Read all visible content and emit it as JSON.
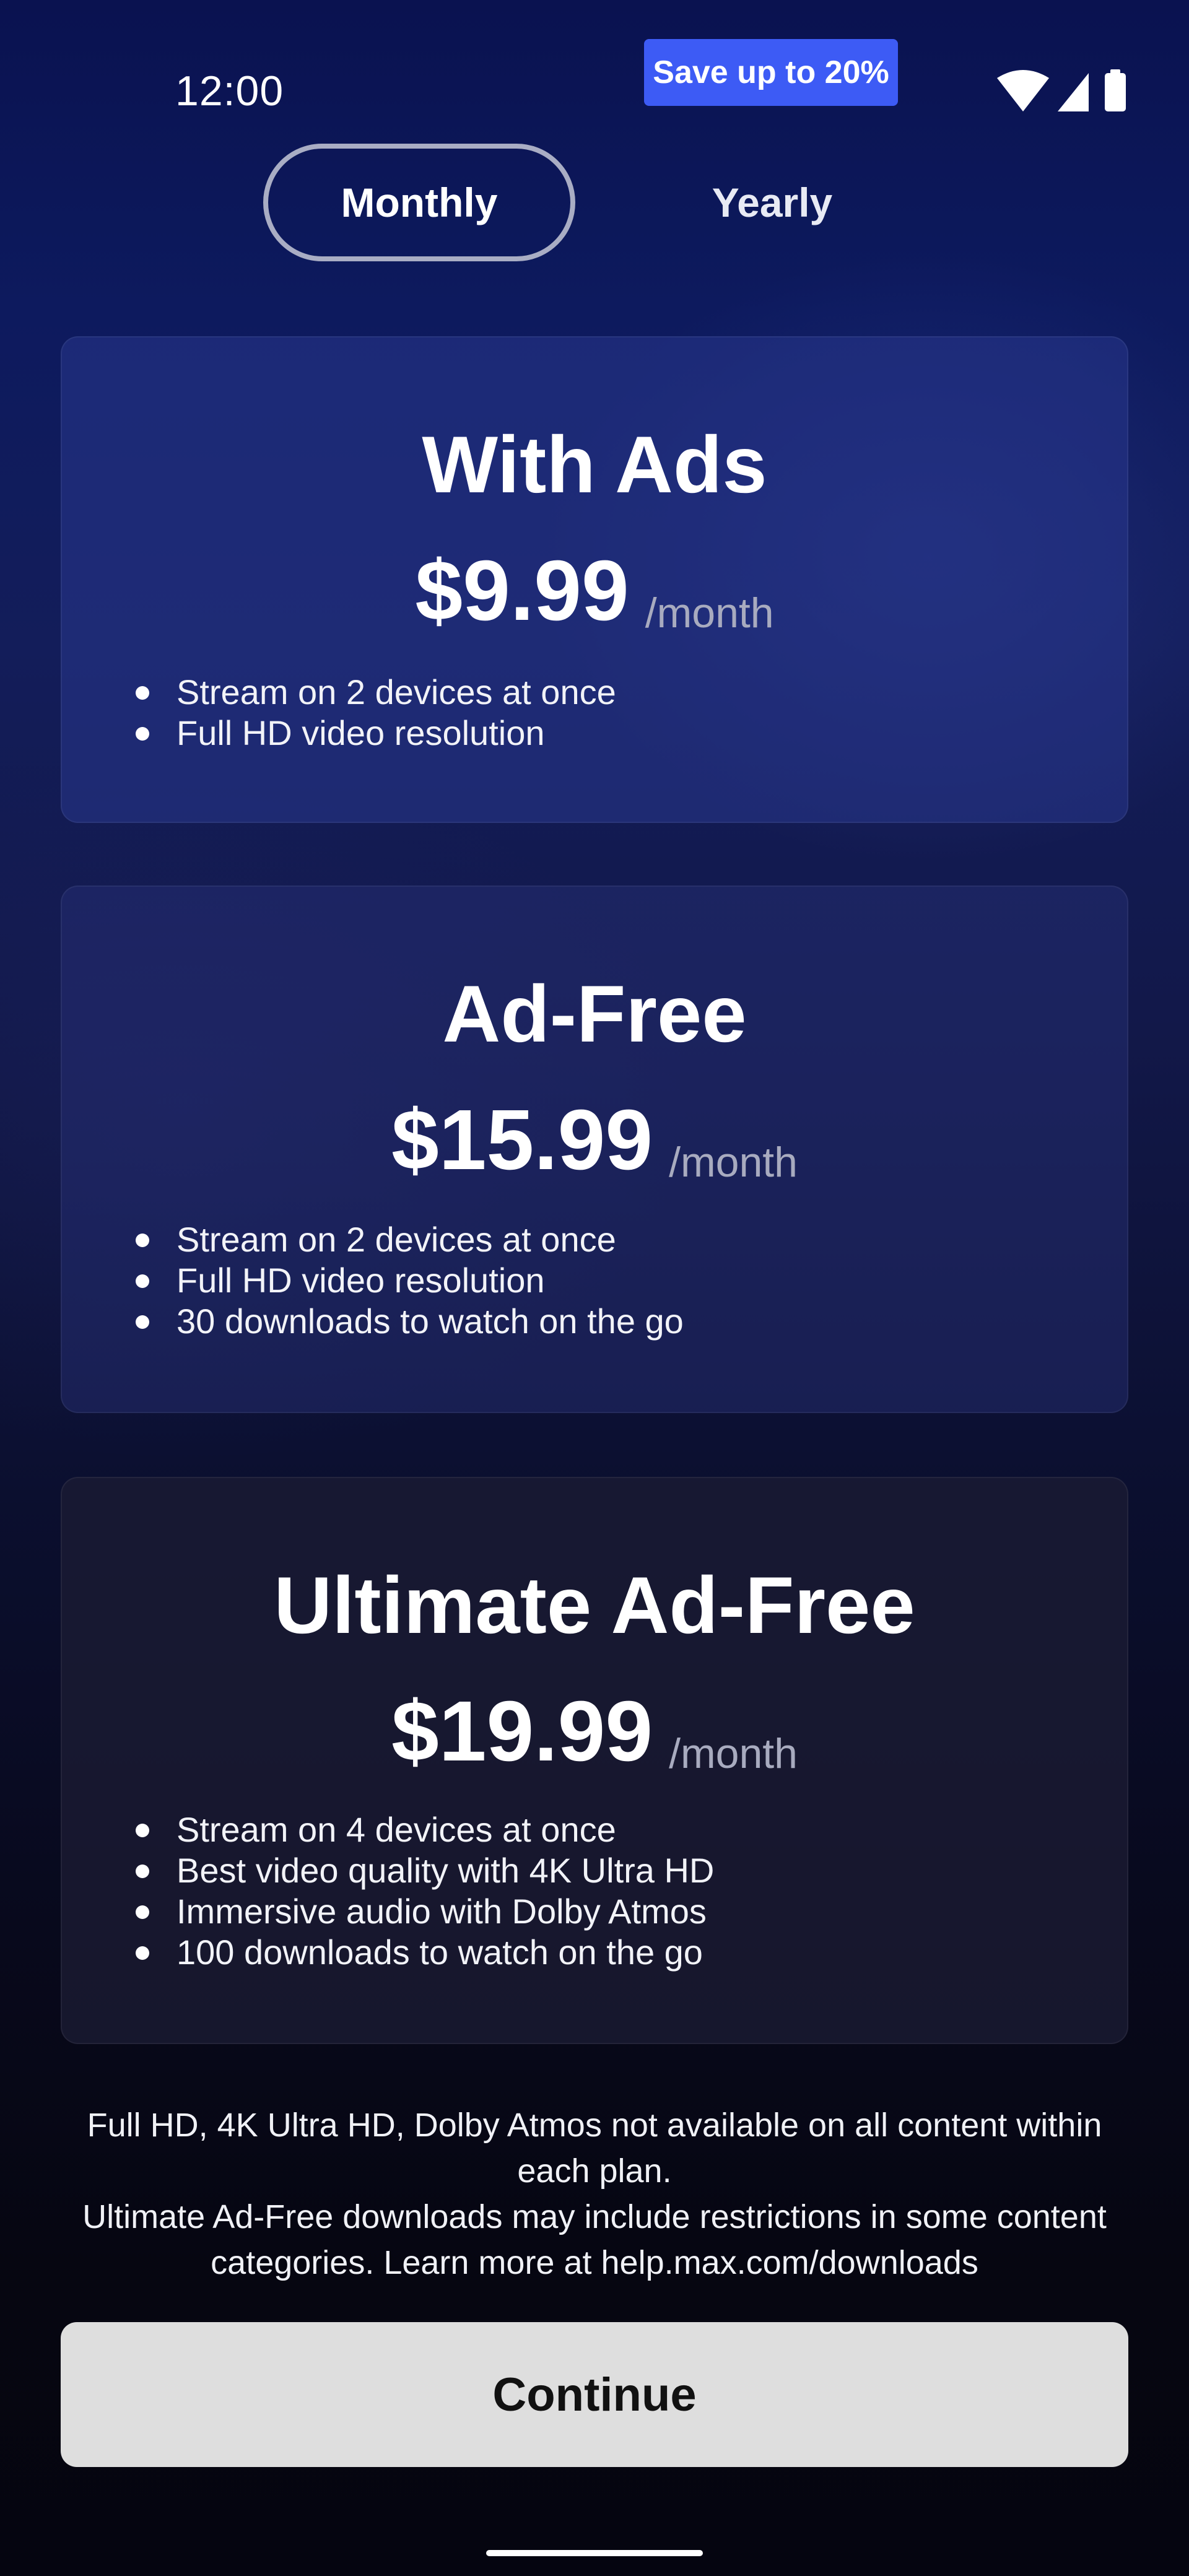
{
  "status_bar": {
    "time": "12:00",
    "icons": [
      "wifi-icon",
      "cellular-signal-icon",
      "battery-icon"
    ]
  },
  "promo_badge": {
    "label": "Save up to 20%",
    "color": "#3d5bf5"
  },
  "billing_toggle": {
    "options": [
      {
        "label": "Monthly",
        "selected": true
      },
      {
        "label": "Yearly",
        "selected": false
      }
    ]
  },
  "plans": [
    {
      "name": "With Ads",
      "price": "$9.99",
      "period": "/month",
      "features": [
        "Stream on 2 devices at once",
        "Full HD video resolution"
      ]
    },
    {
      "name": "Ad-Free",
      "price": "$15.99",
      "period": "/month",
      "features": [
        "Stream on 2 devices at once",
        "Full HD video resolution",
        "30 downloads to watch on the go"
      ]
    },
    {
      "name": "Ultimate Ad-Free",
      "price": "$19.99",
      "period": "/month",
      "features": [
        "Stream on 4 devices at once",
        "Best video quality with 4K Ultra HD",
        "Immersive audio with Dolby Atmos",
        "100 downloads to watch on the go"
      ]
    }
  ],
  "disclaimer": {
    "line1": "Full HD, 4K Ultra HD, Dolby Atmos not available on all content within each plan.",
    "line2": "Ultimate Ad-Free downloads may include restrictions in some content categories. Learn more at help.max.com/downloads"
  },
  "continue_button": {
    "label": "Continue",
    "color": "#dedede"
  }
}
